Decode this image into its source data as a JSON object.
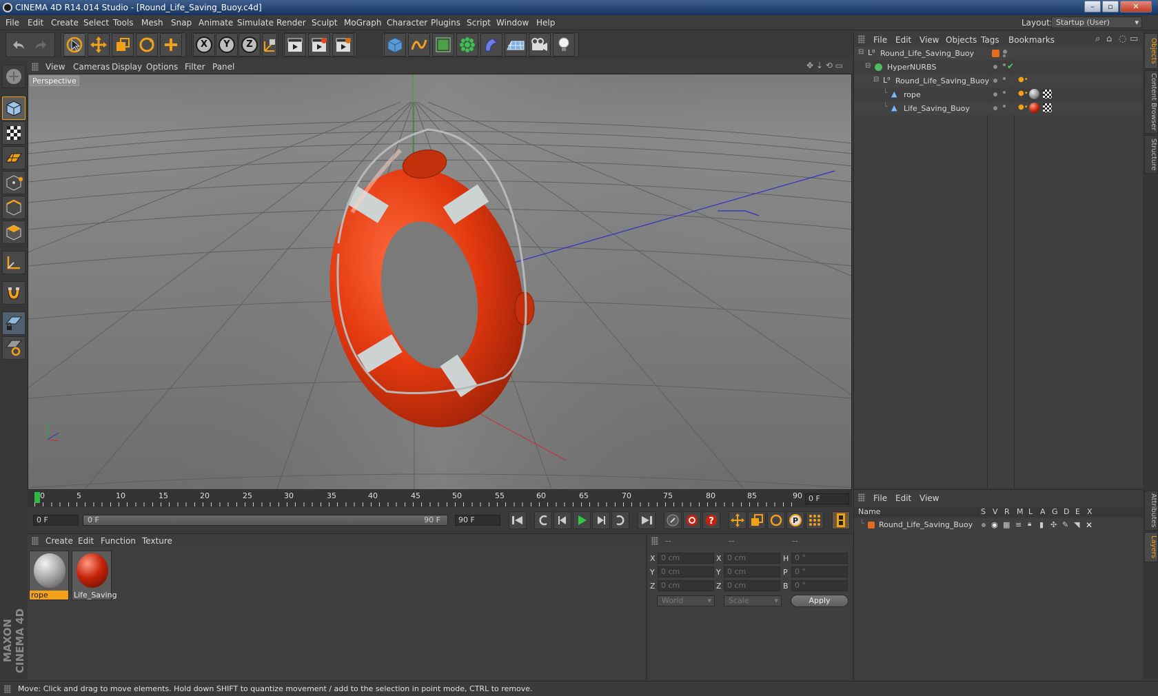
{
  "window": {
    "title": "CINEMA 4D R14.014 Studio - [Round_Life_Saving_Buoy.c4d]",
    "minimize": "–",
    "maximize": "▫",
    "close": "✕"
  },
  "menubar": {
    "items": [
      "File",
      "Edit",
      "Create",
      "Select",
      "Tools",
      "Mesh",
      "Snap",
      "Animate",
      "Simulate",
      "Render",
      "Sculpt",
      "MoGraph",
      "Character",
      "Plugins",
      "Script",
      "Window",
      "Help"
    ],
    "layout_label": "Layout:",
    "layout_value": "Startup (User)"
  },
  "toolbar": {
    "axis_x": "X",
    "axis_y": "Y",
    "axis_z": "Z"
  },
  "viewport": {
    "menus": [
      "View",
      "Cameras",
      "Display",
      "Options",
      "Filter",
      "Panel"
    ],
    "label": "Perspective"
  },
  "object_manager": {
    "menus": [
      "File",
      "Edit",
      "View",
      "Objects",
      "Tags",
      "Bookmarks"
    ],
    "objects": [
      {
        "name": "Round_Life_Saving_Buoy"
      },
      {
        "name": "HyperNURBS"
      },
      {
        "name": "Round_Life_Saving_Buoy"
      },
      {
        "name": "rope"
      },
      {
        "name": "Life_Saving_Buoy"
      }
    ]
  },
  "timeline": {
    "ticks": [
      "0",
      "5",
      "10",
      "15",
      "20",
      "25",
      "30",
      "35",
      "40",
      "45",
      "50",
      "55",
      "60",
      "65",
      "70",
      "75",
      "80",
      "85",
      "90"
    ],
    "current_frame": "0 F",
    "start_frame": "0 F",
    "slider_start": "0 F",
    "slider_end": "90 F",
    "end_frame": "90 F"
  },
  "material_manager": {
    "menus": [
      "Create",
      "Edit",
      "Function",
      "Texture"
    ],
    "materials": [
      {
        "name": "rope",
        "color": "#9a9a9a"
      },
      {
        "name": "Life_Saving",
        "color": "#b3170a"
      }
    ]
  },
  "coordinates": {
    "header": [
      "--",
      "--",
      "--"
    ],
    "rows": [
      {
        "a": "X",
        "av": "0 cm",
        "b": "X",
        "bv": "0 cm",
        "c": "H",
        "cv": "0 °"
      },
      {
        "a": "Y",
        "av": "0 cm",
        "b": "Y",
        "bv": "0 cm",
        "c": "P",
        "cv": "0 °"
      },
      {
        "a": "Z",
        "av": "0 cm",
        "b": "Z",
        "bv": "0 cm",
        "c": "B",
        "cv": "0 °"
      }
    ],
    "mode1": "World",
    "mode2": "Scale",
    "apply": "Apply"
  },
  "layer_manager": {
    "menus": [
      "File",
      "Edit",
      "View"
    ],
    "columns": [
      "Name",
      "S",
      "V",
      "R",
      "M",
      "L",
      "A",
      "G",
      "D",
      "E",
      "X"
    ],
    "rows": [
      {
        "name": "Round_Life_Saving_Buoy"
      }
    ]
  },
  "right_tabs": [
    "Objects",
    "Content Browser",
    "Structure"
  ],
  "right_tabs_lower": [
    "Attributes",
    "Layers"
  ],
  "brand": "MAXON CINEMA 4D",
  "status": "Move: Click and drag to move elements. Hold down SHIFT to quantize movement / add to the selection in point mode, CTRL to remove.",
  "colors": {
    "accent": "#f4a11a",
    "buoy": "#e2380f",
    "stripe": "#cdd3d3",
    "active_orange": "#e66c1d"
  }
}
